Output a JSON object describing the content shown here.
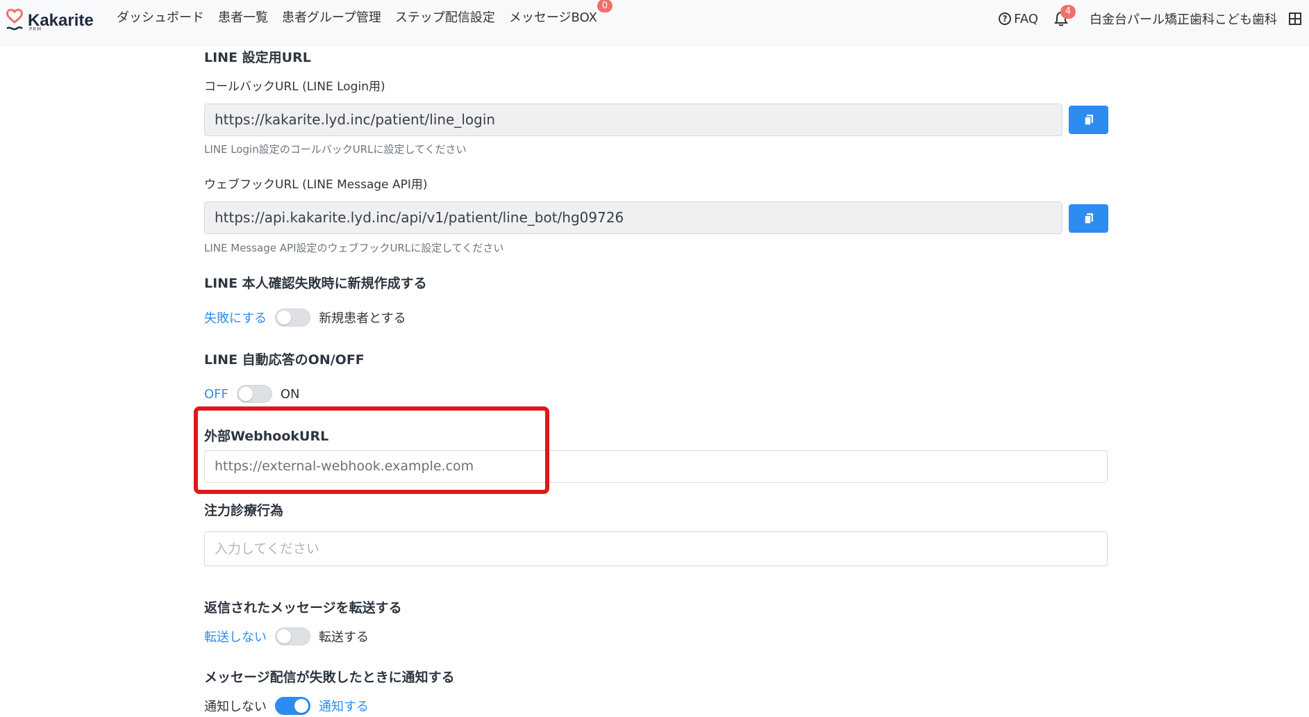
{
  "header": {
    "logo_text": "Kakarite",
    "logo_sub": "PRM",
    "nav": [
      {
        "label": "ダッシュボード"
      },
      {
        "label": "患者一覧"
      },
      {
        "label": "患者グループ管理"
      },
      {
        "label": "ステップ配信設定"
      },
      {
        "label": "メッセージBOX",
        "badge": "0"
      }
    ],
    "faq_label": "FAQ",
    "notification_count": "4",
    "clinic_name": "白金台パール矯正歯科こども歯科"
  },
  "line_url_section": {
    "title": "LINE 設定用URL",
    "callback": {
      "label": "コールバックURL (LINE Login用)",
      "value": "https://kakarite.lyd.inc/patient/line_login",
      "help": "LINE Login設定のコールバックURLに設定してください"
    },
    "webhook": {
      "label": "ウェブフックURL (LINE Message API用)",
      "value": "https://api.kakarite.lyd.inc/api/v1/patient/line_bot/hg09726",
      "help": "LINE Message API設定のウェブフックURLに設定してください"
    }
  },
  "identity_fail": {
    "title": "LINE 本人確認失敗時に新規作成する",
    "left": "失敗にする",
    "right": "新規患者とする",
    "on": false
  },
  "auto_reply": {
    "title": "LINE 自動応答のON/OFF",
    "left": "OFF",
    "right": "ON",
    "on": false
  },
  "external_webhook": {
    "title": "外部WebhookURL",
    "value": "https://external-webhook.example.com"
  },
  "focus_treatment": {
    "title": "注力診療行為",
    "placeholder": "入力してください"
  },
  "forward_reply": {
    "title": "返信されたメッセージを転送する",
    "left": "転送しない",
    "right": "転送する",
    "on": false
  },
  "notify_failure": {
    "title": "メッセージ配信が失敗したときに通知する",
    "left": "通知しない",
    "right": "通知する",
    "on": true
  },
  "colors": {
    "accent": "#2d8cf0",
    "highlight": "#e01818",
    "badge": "#f0706a"
  }
}
